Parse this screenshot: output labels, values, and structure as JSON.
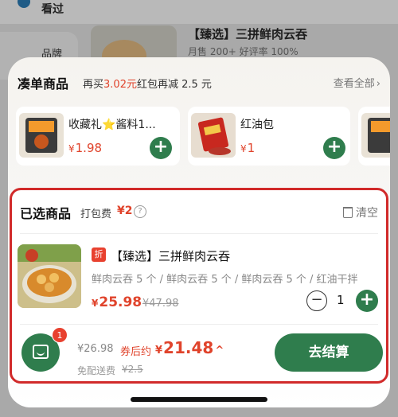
{
  "background": {
    "seen_label": "看过",
    "side_label": "品牌",
    "product_title": "【臻选】三拼鲜肉云吞",
    "product_sub": "月售 200+ 好评率 100%"
  },
  "combo": {
    "title": "凑单商品",
    "tip_prefix": "再买",
    "tip_amount": "3.02元",
    "tip_suffix": "红包再减 2.5 元",
    "view_all": "查看全部",
    "items": [
      {
        "name": "收藏礼⭐酱料1...",
        "price": "1.98",
        "currency": "¥"
      },
      {
        "name": "红油包",
        "price": "1",
        "currency": "¥"
      }
    ]
  },
  "selected": {
    "title": "已选商品",
    "pack_label": "打包费",
    "pack_fee": "¥2",
    "info_glyph": "?",
    "clear_label": "清空",
    "item": {
      "badge": "折",
      "name": "【臻选】三拼鲜肉云吞",
      "spec": "鲜肉云吞 5 个 / 鲜肉云吞 5 个 / 鲜肉云吞 5 个 / 红油干拌",
      "currency": "¥",
      "price": "25.98",
      "orig_price": "¥47.98",
      "quantity": "1"
    }
  },
  "footer": {
    "cart_count": "1",
    "total": "¥26.98",
    "after_coupon_label": "券后约",
    "after_coupon_currency": "¥",
    "after_coupon_price": "21.48",
    "delivery_label": "免配送费",
    "delivery_orig": "¥2.5",
    "checkout_label": "去结算"
  },
  "colors": {
    "brand_green": "#2f7d4d",
    "price_red": "#e0432b",
    "highlight_border": "#d12a2a"
  },
  "icons": [
    "plus-icon",
    "minus-icon",
    "trash-icon",
    "info-icon",
    "cart-bag-icon",
    "chevron-right-icon",
    "chevron-up-icon"
  ]
}
